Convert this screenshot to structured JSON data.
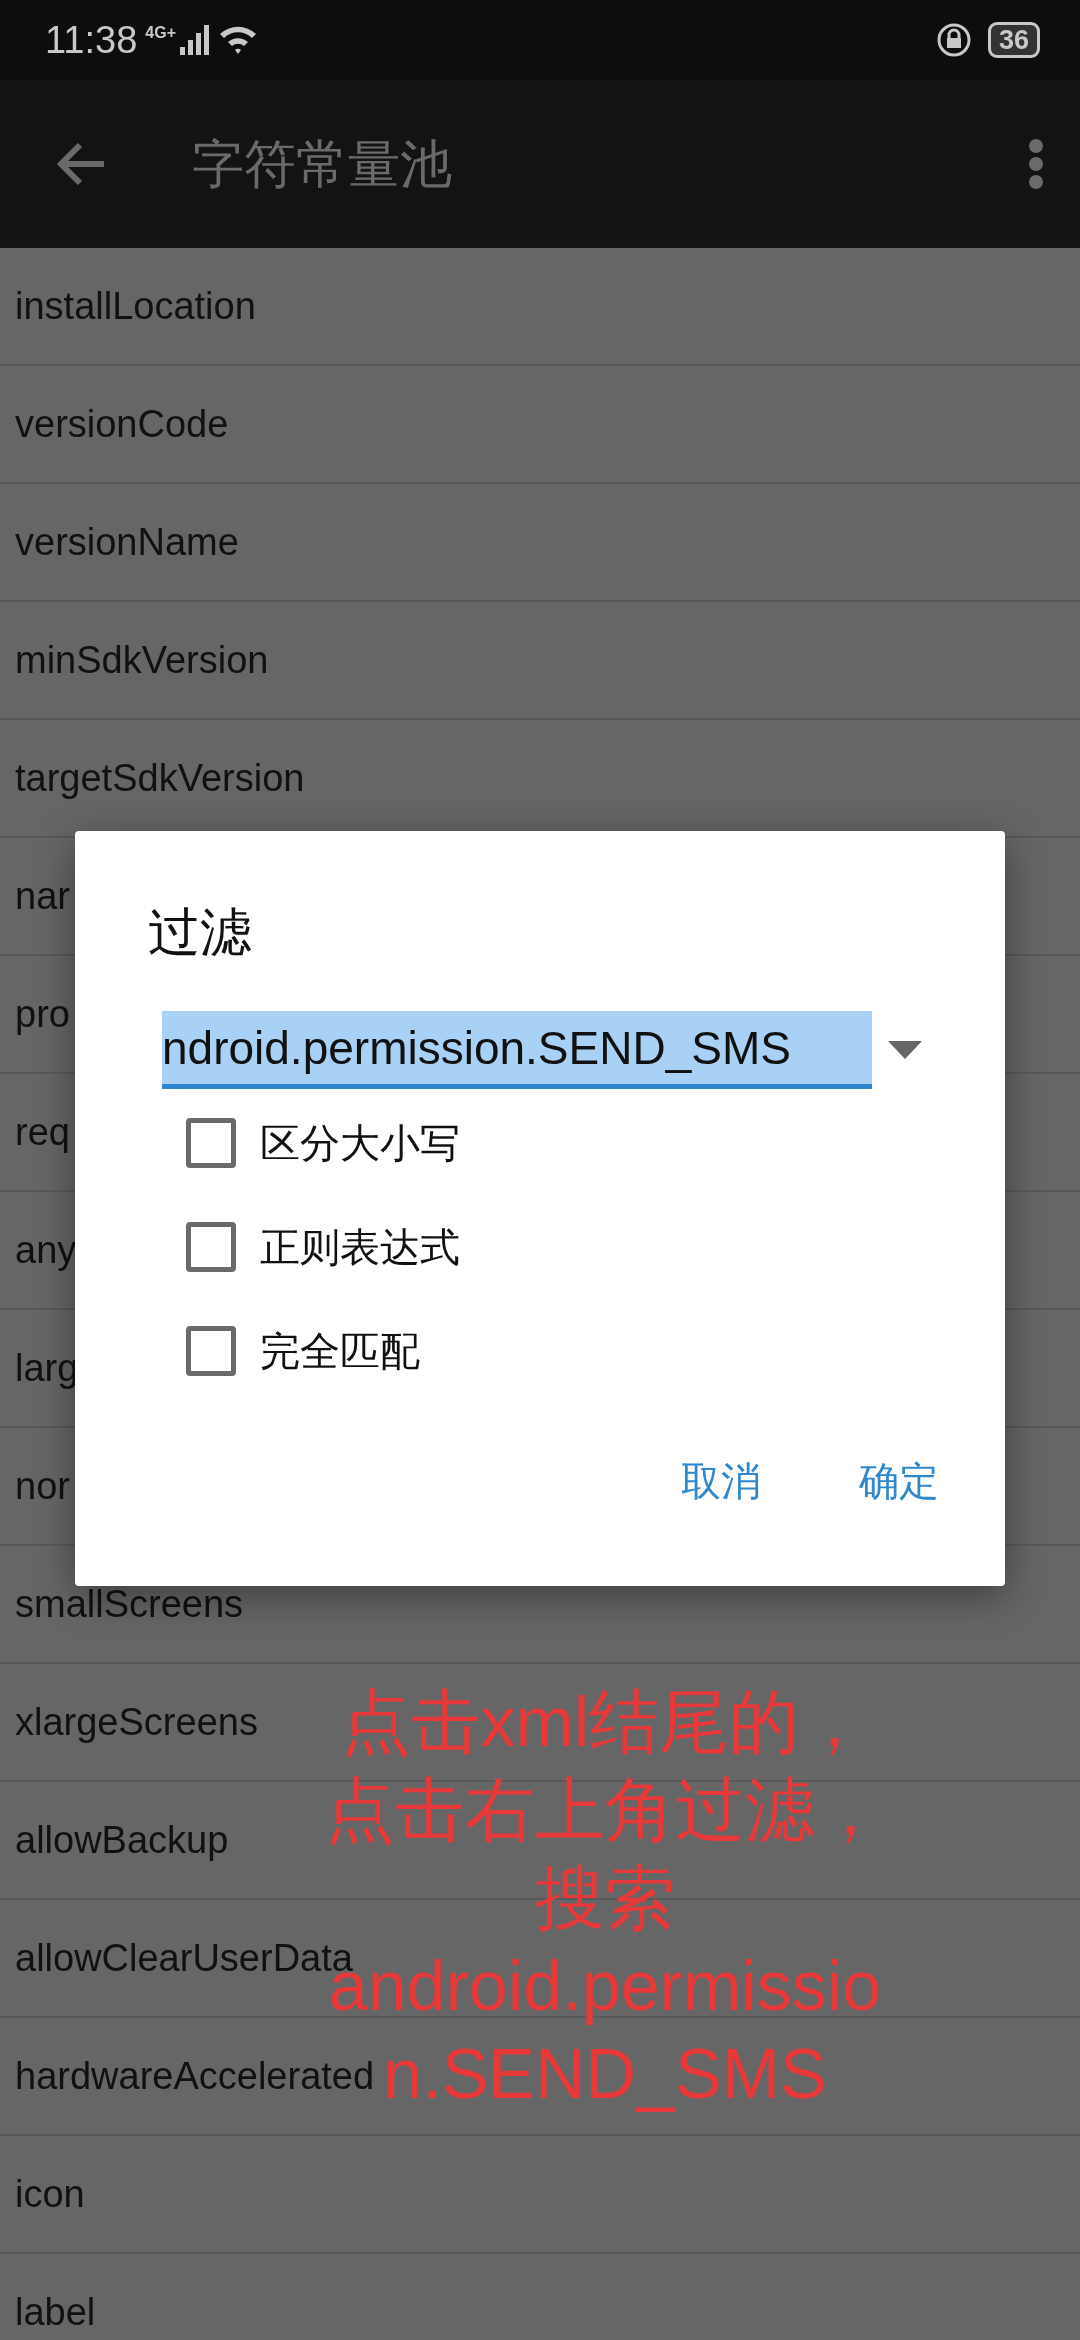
{
  "status_bar": {
    "time": "11:38",
    "network": "4G+",
    "battery": "36"
  },
  "toolbar": {
    "title": "字符常量池"
  },
  "list": {
    "items": [
      "installLocation",
      "versionCode",
      "versionName",
      "minSdkVersion",
      "targetSdkVersion",
      "nar",
      "pro",
      "req",
      "any",
      "larg",
      "nor",
      "smallScreens",
      "xlargeScreens",
      "allowBackup",
      "allowClearUserData",
      "hardwareAccelerated",
      "icon",
      "label"
    ]
  },
  "dialog": {
    "title": "过滤",
    "filter": {
      "value": "ndroid.permission.SEND_SMS",
      "selected": true
    },
    "options": [
      {
        "label": "区分大小写",
        "checked": false
      },
      {
        "label": "正则表达式",
        "checked": false
      },
      {
        "label": "完全匹配",
        "checked": false
      }
    ],
    "buttons": [
      "取消",
      "确定"
    ]
  },
  "annotation": {
    "lines": [
      "点击xml结尾的，",
      "点击右上角过滤，",
      "搜索",
      "android.permissio",
      "n.SEND_SMS"
    ]
  }
}
